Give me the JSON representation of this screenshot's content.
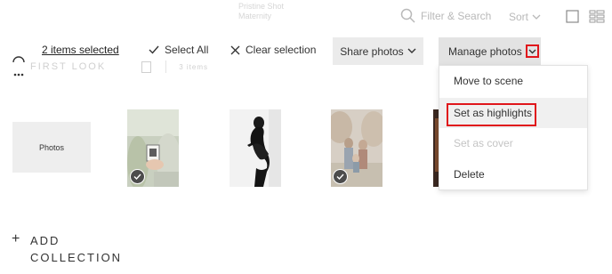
{
  "top_faint": {
    "line1": "Pristine Shot",
    "line2": "Maternity"
  },
  "search": {
    "placeholder": "Filter & Search"
  },
  "sort": {
    "label": "Sort"
  },
  "collection": {
    "title": "FIRST LOOK",
    "count": "3 items"
  },
  "selection_bar": {
    "items_selected": "2 items selected",
    "select_all": "Select All",
    "clear_selection": "Clear selection",
    "share_photos": "Share photos",
    "manage_photos": "Manage photos"
  },
  "manage_menu": {
    "items": [
      {
        "label": "Move to scene",
        "enabled": true
      },
      {
        "label": "Set as highlights",
        "enabled": true,
        "highlighted": true
      },
      {
        "label": "Set as cover",
        "enabled": false
      },
      {
        "label": "Delete",
        "enabled": true
      }
    ]
  },
  "gallery": {
    "photos_tile_label": "Photos",
    "photos": [
      {
        "description": "hands holding ultrasound",
        "selected": true
      },
      {
        "description": "maternity silhouette",
        "selected": false
      },
      {
        "description": "family outdoors",
        "selected": true
      },
      {
        "description": "partial photo",
        "selected": false
      }
    ]
  },
  "add_collection": {
    "line1": "ADD",
    "line2": "COLLECTION"
  },
  "colors": {
    "accent_red": "#e0161b",
    "button_bg": "#ebebeb",
    "menu_highlight": "#f0f0f0",
    "check_badge": "#4c4c4c"
  }
}
